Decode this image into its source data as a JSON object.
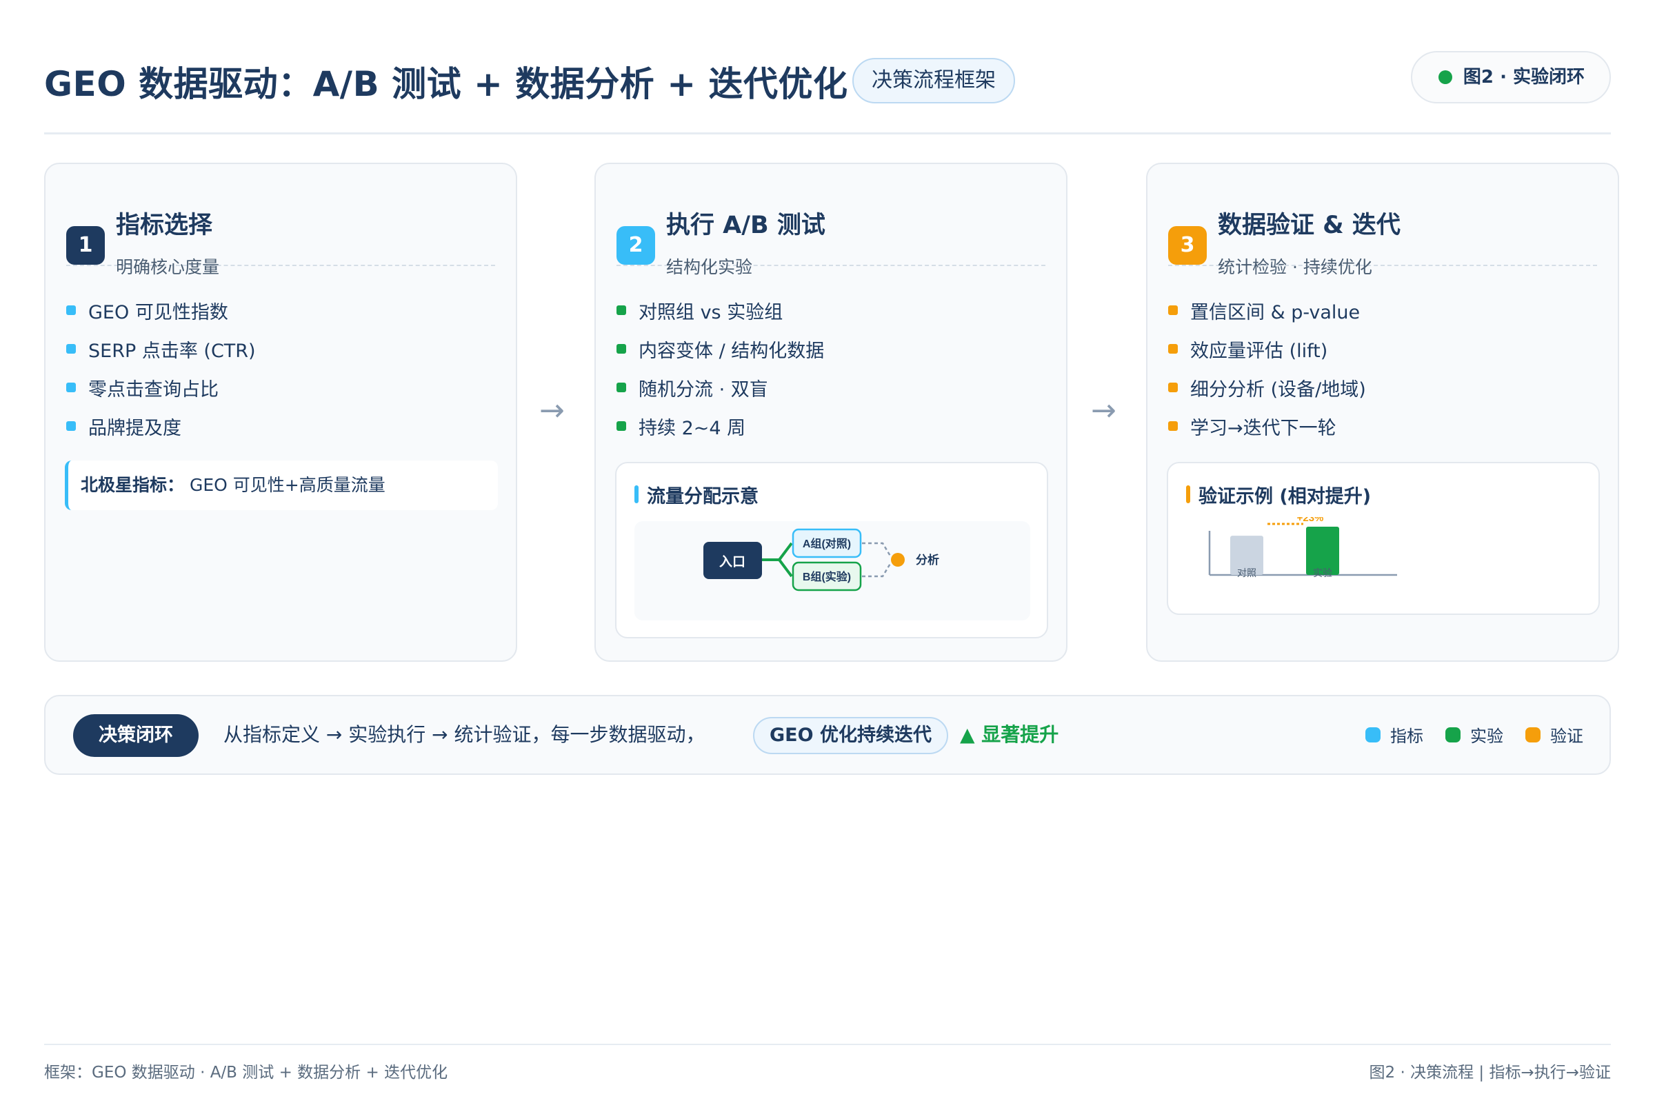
{
  "header": {
    "title": "GEO 数据驱动：A/B 测试 + 数据分析 + 迭代优化",
    "subtitle_pill": "决策流程框架",
    "figure_pill": "图2 · 实验闭环"
  },
  "colors": {
    "navy": "#1e3a5f",
    "indicator": "#38bdf8",
    "experiment": "#16a34a",
    "validation": "#f59e0b"
  },
  "cards": [
    {
      "number": "1",
      "title": "指标选择",
      "subtitle": "明确核心度量",
      "bullets": [
        "GEO 可见性指数",
        "SERP 点击率 (CTR)",
        "零点击查询占比",
        "品牌提及度"
      ],
      "north_star_label": "北极星指标：",
      "north_star_value": " GEO 可见性+高质量流量"
    },
    {
      "number": "2",
      "title": "执行 A/B 测试",
      "subtitle": "结构化实验",
      "bullets": [
        "对照组 vs 实验组",
        "内容变体 / 结构化数据",
        "随机分流 · 双盲",
        "持续 2~4 周"
      ],
      "flow_title": "流量分配示意",
      "flow": {
        "entry": "入口",
        "group_a": "A组(对照)",
        "group_b": "B组(实验)",
        "analysis": "分析"
      }
    },
    {
      "number": "3",
      "title": "数据验证 & 迭代",
      "subtitle": "统计检验 · 持续优化",
      "bullets": [
        "置信区间 & p-value",
        "效应量评估 (lift)",
        "细分分析 (设备/地域)",
        "学习→迭代下一轮"
      ],
      "chart_title": "验证示例 (相对提升)"
    }
  ],
  "arrows": [
    "→",
    "→"
  ],
  "chart_data": {
    "type": "bar",
    "categories": [
      "对照",
      "实验"
    ],
    "values": [
      1.0,
      1.23
    ],
    "annotation": "+23%",
    "colors": [
      "#cbd5e1",
      "#16a34a"
    ]
  },
  "bottom": {
    "loop_label": "决策闭环",
    "text": "从指标定义 → 实验执行 → 统计验证，每一步数据驱动，",
    "geo_pill": "GEO 优化持续迭代",
    "lift_label": "▲ 显著提升",
    "legend": [
      {
        "label": "指标",
        "color": "#38bdf8"
      },
      {
        "label": "实验",
        "color": "#16a34a"
      },
      {
        "label": "验证",
        "color": "#f59e0b"
      }
    ]
  },
  "footer": {
    "left": "框架：GEO 数据驱动 · A/B 测试 + 数据分析 + 迭代优化",
    "right": "图2 · 决策流程 | 指标→执行→验证"
  }
}
